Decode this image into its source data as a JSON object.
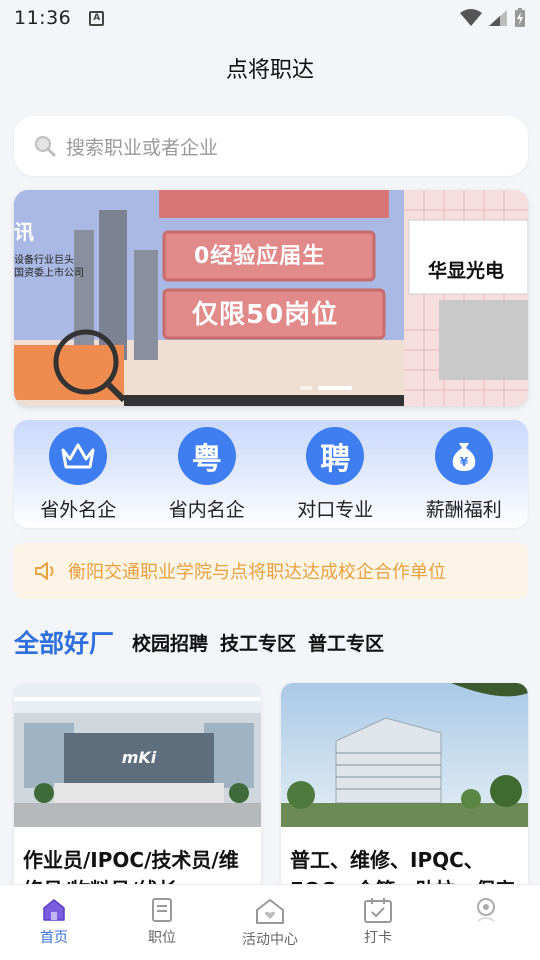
{
  "status": {
    "time": "11:36"
  },
  "title": "点将职达",
  "search": {
    "placeholder": "搜索职业或者企业"
  },
  "banner": {
    "logo_text": "讯",
    "small_text": "设备行业巨头\n国资委上市公司",
    "line1": "0经验应届生",
    "line2": "仅限50岗位",
    "brand": "华显光电"
  },
  "categories": [
    {
      "label": "省外名企",
      "icon": "crown-icon",
      "glyph": "♛"
    },
    {
      "label": "省内名企",
      "icon": "yue-icon",
      "glyph": "粤"
    },
    {
      "label": "对口专业",
      "icon": "pin-icon",
      "glyph": "聘"
    },
    {
      "label": "薪酬福利",
      "icon": "money-bag-icon",
      "glyph": "¥"
    }
  ],
  "notice": {
    "text": "衡阳交通职业学院与点将职达达成校企合作单位"
  },
  "tabs": [
    {
      "label": "全部好厂",
      "active": true
    },
    {
      "label": "校园招聘"
    },
    {
      "label": "技工专区"
    },
    {
      "label": "普工专区"
    }
  ],
  "cards": [
    {
      "title": "作业员/IPOC/技术员/维修员/物料员/线长"
    },
    {
      "title": "普工、维修、IPQC、FQC、仓管、助拉、保安"
    }
  ],
  "nav": [
    {
      "label": "首页",
      "icon": "home-icon",
      "active": true
    },
    {
      "label": "职位",
      "icon": "document-icon"
    },
    {
      "label": "活动中心",
      "icon": "activity-house-icon"
    },
    {
      "label": "打卡",
      "icon": "calendar-check-icon"
    },
    {
      "label": "",
      "icon": "profile-icon"
    }
  ],
  "colors": {
    "accent": "#2f6fde",
    "notice": "#e8a13f",
    "category_circle": "#3f7ef0"
  }
}
